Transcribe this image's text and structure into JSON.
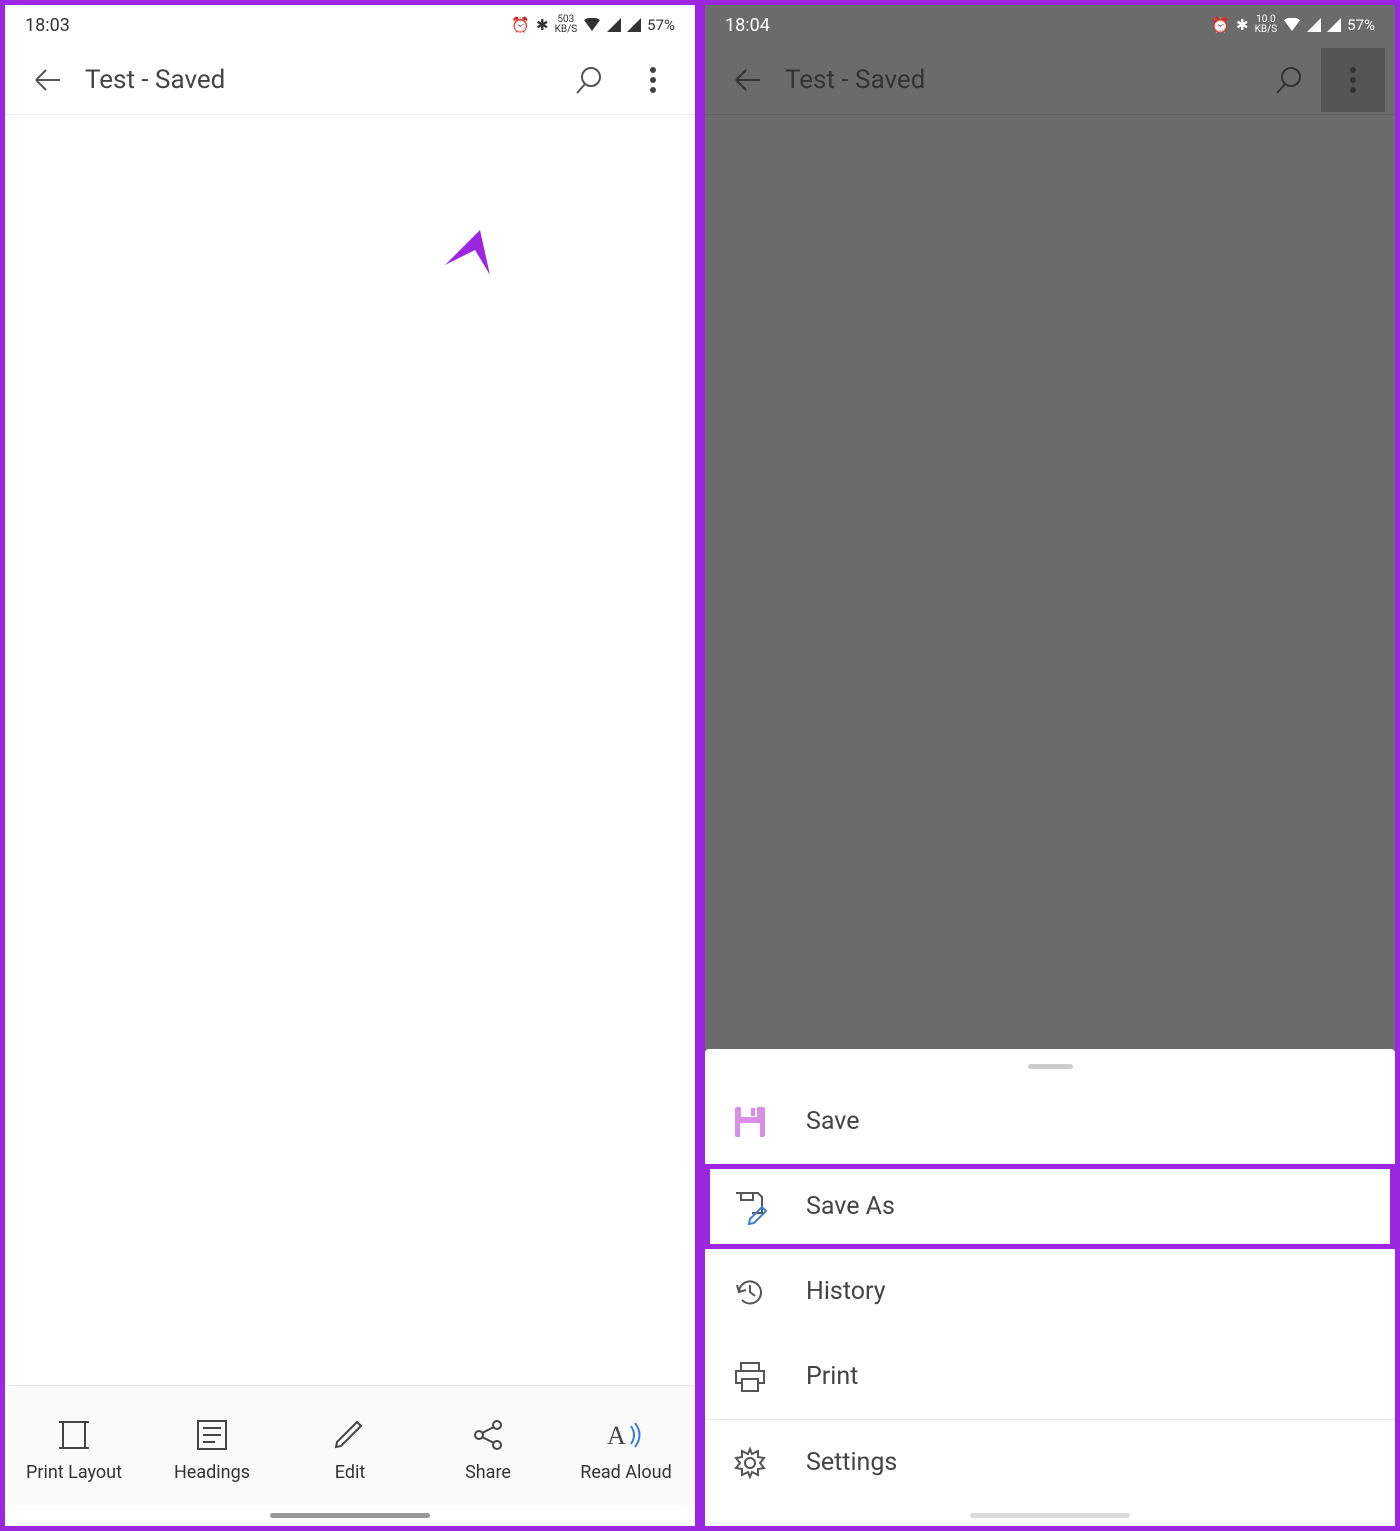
{
  "left": {
    "status": {
      "time": "18:03",
      "speed": "503",
      "speed_unit": "KB/S",
      "battery": "57%"
    },
    "toolbar": {
      "title": "Test - Saved"
    },
    "bottom": {
      "print_layout": "Print Layout",
      "headings": "Headings",
      "edit": "Edit",
      "share": "Share",
      "read_aloud": "Read Aloud"
    }
  },
  "right": {
    "status": {
      "time": "18:04",
      "speed": "10.0",
      "speed_unit": "KB/S",
      "battery": "57%"
    },
    "toolbar": {
      "title": "Test - Saved"
    },
    "menu": {
      "save": "Save",
      "save_as": "Save As",
      "history": "History",
      "print": "Print",
      "settings": "Settings"
    }
  },
  "colors": {
    "accent": "#9c27e0"
  }
}
